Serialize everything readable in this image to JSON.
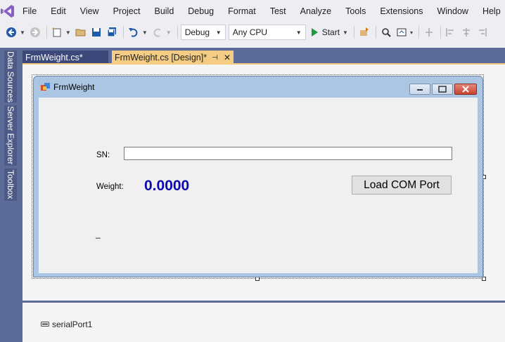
{
  "menu": [
    "File",
    "Edit",
    "View",
    "Project",
    "Build",
    "Debug",
    "Format",
    "Test",
    "Analyze",
    "Tools",
    "Extensions",
    "Window",
    "Help"
  ],
  "toolbar": {
    "configuration": "Debug",
    "platform": "Any CPU",
    "start_label": "Start"
  },
  "side_panels": [
    "Data Sources",
    "Server Explorer",
    "Toolbox"
  ],
  "tabs": [
    {
      "label": "FrmWeight.cs*"
    },
    {
      "label": "FrmWeight.cs [Design]*",
      "pin": "⊣",
      "close": "✕"
    }
  ],
  "form": {
    "title": "FrmWeight",
    "sn_label": "SN:",
    "sn_value": "",
    "weight_label": "Weight:",
    "weight_value": "0.0000",
    "load_button": "Load COM Port",
    "status_text": "_"
  },
  "components": [
    {
      "label": "serialPort1",
      "icon": "serial-port-icon"
    }
  ],
  "colors": {
    "accent": "#f5cc84",
    "frame": "#5d6b99",
    "weight_text": "#0a0ab0"
  }
}
